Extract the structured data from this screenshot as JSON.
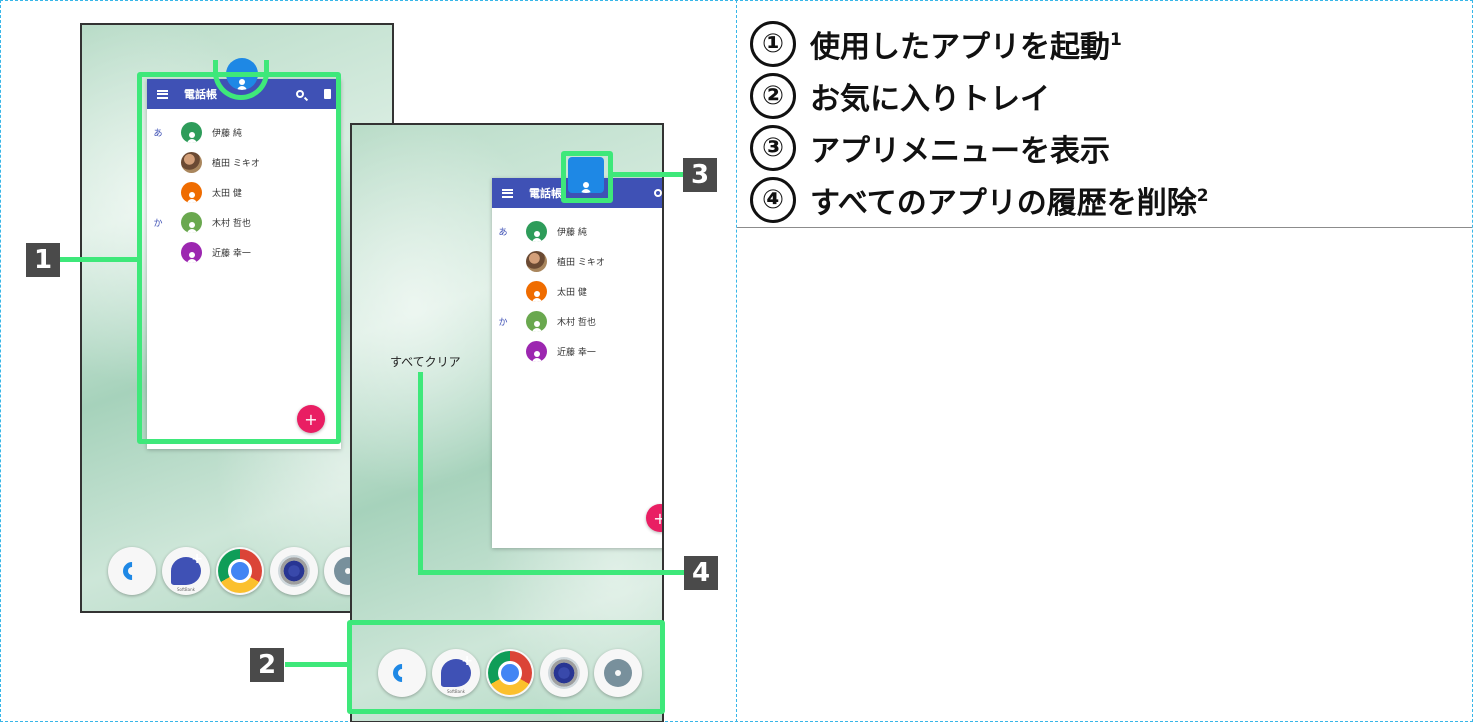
{
  "legend": [
    {
      "num": "①",
      "text": "使用したアプリを起動",
      "sup": "1"
    },
    {
      "num": "②",
      "text": "お気に入りトレイ",
      "sup": ""
    },
    {
      "num": "③",
      "text": "アプリメニューを表示",
      "sup": ""
    },
    {
      "num": "④",
      "text": "すべてのアプリの履歴を削除",
      "sup": "2"
    }
  ],
  "callouts": {
    "c1": "1",
    "c2": "2",
    "c3": "3",
    "c4": "4"
  },
  "contacts_app": {
    "title": "電話帳",
    "title_truncated": "電話帳",
    "contacts": [
      {
        "section": "あ",
        "name": "伊藤 純",
        "avatar_color": "#2e9c5a"
      },
      {
        "section": "",
        "name": "植田 ミキオ",
        "avatar_color": "photo"
      },
      {
        "section": "",
        "name": "太田 健",
        "avatar_color": "#ef6c00"
      },
      {
        "section": "か",
        "name": "木村 哲也",
        "avatar_color": "#6aa84f"
      },
      {
        "section": "",
        "name": "近藤 幸一",
        "avatar_color": "#9c27b0"
      }
    ],
    "fab_label": "+"
  },
  "recents": {
    "clear_all_label": "すべてクリア"
  },
  "dock": {
    "icons": [
      "phone-icon",
      "softbank-message-icon",
      "chrome-icon",
      "camera-icon",
      "settings-icon"
    ],
    "softbank_text": "SoftBank"
  },
  "colors": {
    "callout": "#3ee87a",
    "appbar": "#3f51b5",
    "fab": "#e91e63",
    "frame": "#38b6e8"
  }
}
